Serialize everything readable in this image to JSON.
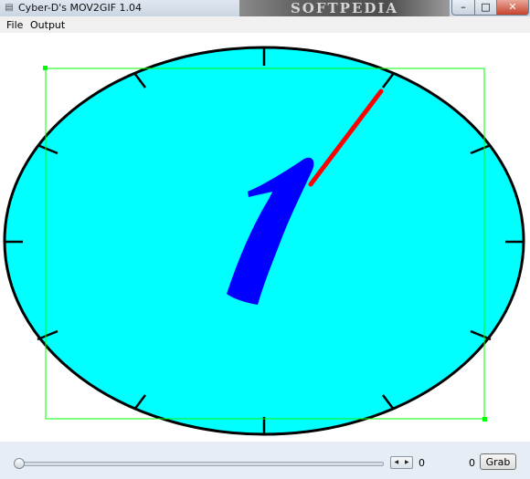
{
  "window": {
    "title": "Cyber-D's MOV2GIF 1.04",
    "watermark": "SOFTPEDIA",
    "minimize_glyph": "–",
    "maximize_glyph": "□",
    "close_glyph": "✕",
    "app_icon": "film-icon"
  },
  "menu": {
    "file": "File",
    "output": "Output"
  },
  "preview": {
    "dial_color": "#00ffff",
    "numeral": "1",
    "numeral_color": "#0000ff",
    "hand_color": "#ff0000",
    "crop_box_color": "#00ff00"
  },
  "controls": {
    "spin_left_glyph": "◀",
    "spin_right_glyph": "▶",
    "frame_value_left": "0",
    "frame_value_right": "0",
    "grab_label": "Grab"
  }
}
